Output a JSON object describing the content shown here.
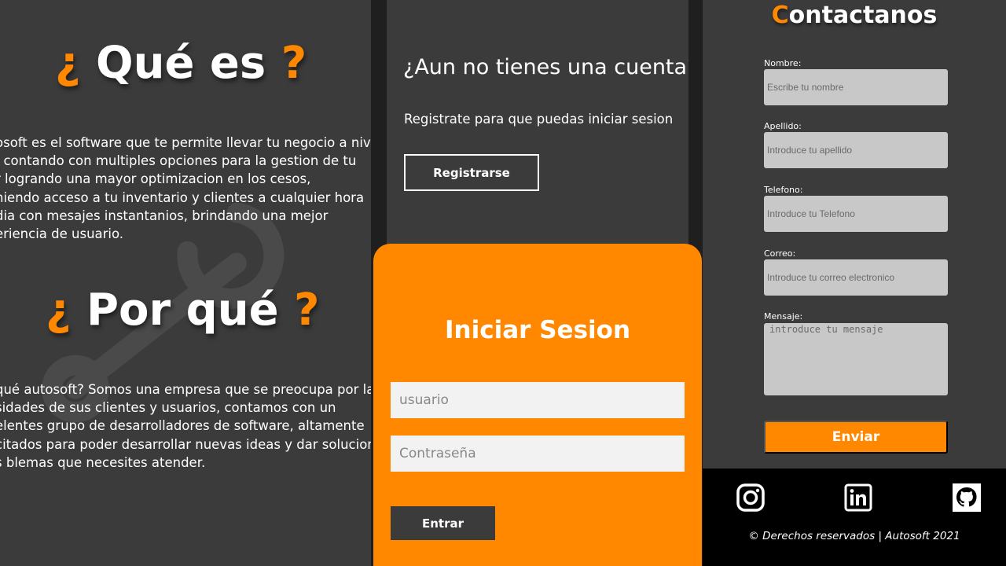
{
  "about": {
    "heading_what_open": "¿",
    "heading_what_text": "Qué es",
    "heading_what_close": "?",
    "what_lines": [
      "osoft es el software que te permite llevar tu negocio a nivel",
      ", contando con multiples opciones para la gestion de tu",
      "r logrando una mayor optimizacion en los cesos,",
      "niendo acceso a tu inventario y clientes a cualquier hora",
      "dia con mesajes instantanios, brindando una mejor",
      "eriencia de usuario."
    ],
    "heading_why_open": "¿",
    "heading_why_text": "Por qué",
    "heading_why_close": "?",
    "why_lines": [
      "qué autosoft? Somos una empresa que se preocupa por las",
      "sidades de sus clientes y usuarios, contamos con un",
      "elentes grupo de desarrolladores de software, altamente",
      "citados para poder desarrollar nuevas ideas y dar solucion",
      "s blemas que necesites atender."
    ]
  },
  "register": {
    "title": "¿Aun no tienes una cuenta?",
    "subtitle": "Registrate para que puedas iniciar sesion",
    "button": "Registrarse"
  },
  "login": {
    "title": "Iniciar Sesion",
    "user_placeholder": "usuario",
    "pass_placeholder": "Contraseña",
    "button": "Entrar"
  },
  "contact": {
    "title_first": "C",
    "title_rest": "ontactanos",
    "fields": [
      {
        "label": "Nombre:",
        "placeholder": "Escribe tu nombre"
      },
      {
        "label": "Apellido:",
        "placeholder": "Introduce tu apellido"
      },
      {
        "label": "Telefono:",
        "placeholder": "Introduce tu Telefono"
      },
      {
        "label": "Correo:",
        "placeholder": "Introduce tu correo electronico"
      }
    ],
    "message_label": "Mensaje:",
    "message_placeholder": "introduce tu mensaje",
    "button": "Enviar"
  },
  "footer": {
    "icons": [
      "instagram-icon",
      "linkedin-icon",
      "github-icon"
    ],
    "copyright": "© Derechos reservados | Autosoft 2021"
  },
  "colors": {
    "accent": "#ff8800",
    "panel": "#3b3b3b",
    "footer": "#000000"
  }
}
